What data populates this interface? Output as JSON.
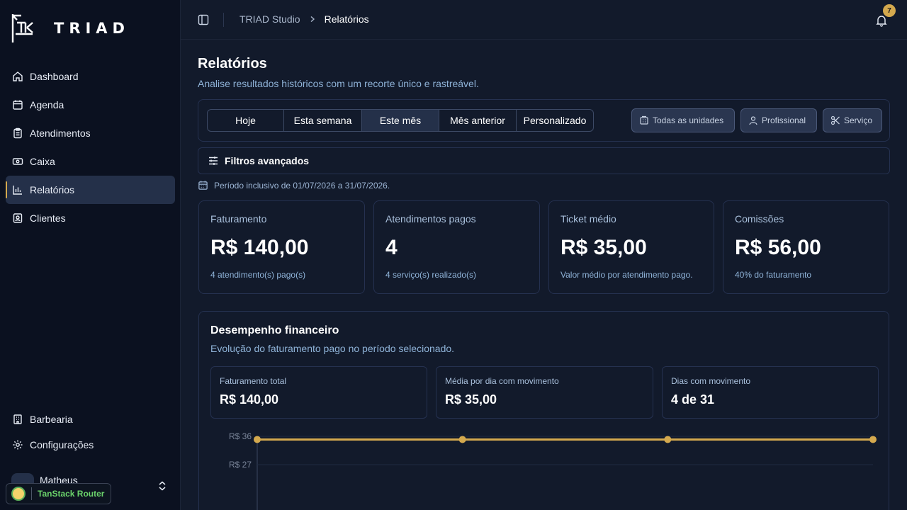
{
  "brand": {
    "name": "TRIAD"
  },
  "sidebar": {
    "items": [
      {
        "label": "Dashboard",
        "icon": "home-icon"
      },
      {
        "label": "Agenda",
        "icon": "calendar-icon"
      },
      {
        "label": "Atendimentos",
        "icon": "clipboard-icon"
      },
      {
        "label": "Caixa",
        "icon": "cash-icon"
      },
      {
        "label": "Relatórios",
        "icon": "bar-chart-icon",
        "active": true
      },
      {
        "label": "Clientes",
        "icon": "contact-icon"
      }
    ],
    "bottom_items": [
      {
        "label": "Barbearia",
        "icon": "building-icon"
      },
      {
        "label": "Configurações",
        "icon": "gear-icon"
      }
    ],
    "user": {
      "name": "Matheus"
    },
    "tanstack": {
      "label": "TanStack Router"
    }
  },
  "header": {
    "breadcrumb": [
      "TRIAD Studio",
      "Relatórios"
    ],
    "notifications": "7"
  },
  "page": {
    "title": "Relatórios",
    "subtitle": "Analise resultados históricos com um recorte único e rastreável."
  },
  "filters": {
    "periods": [
      "Hoje",
      "Esta semana",
      "Este mês",
      "Mês anterior",
      "Personalizado"
    ],
    "active_period": "Este mês",
    "units": "Todas as unidades",
    "professional": "Profissional",
    "service": "Serviço",
    "advanced": "Filtros avançados",
    "period_note": "Período inclusivo de 01/07/2026 a 31/07/2026."
  },
  "stats": [
    {
      "label": "Faturamento",
      "value": "R$ 140,00",
      "note": "4 atendimento(s) pago(s)"
    },
    {
      "label": "Atendimentos pagos",
      "value": "4",
      "note": "4 serviço(s) realizado(s)"
    },
    {
      "label": "Ticket médio",
      "value": "R$ 35,00",
      "note": "Valor médio por atendimento pago."
    },
    {
      "label": "Comissões",
      "value": "R$ 56,00",
      "note": "40% do faturamento"
    }
  ],
  "performance": {
    "title": "Desempenho financeiro",
    "subtitle": "Evolução do faturamento pago no período selecionado.",
    "metrics": [
      {
        "label": "Faturamento total",
        "value": "R$ 140,00"
      },
      {
        "label": "Média por dia com movimento",
        "value": "R$ 35,00"
      },
      {
        "label": "Dias com movimento",
        "value": "4 de 31"
      }
    ]
  },
  "colors": {
    "accent": "#d4a94e",
    "background": "#121a2b",
    "sidebar": "#0b1120"
  },
  "chart_data": {
    "type": "line",
    "y_ticks": [
      "R$ 36",
      "R$ 27"
    ],
    "series": [
      {
        "values": [
          35,
          35,
          35,
          35
        ]
      }
    ],
    "ylim": [
      0,
      36
    ]
  }
}
